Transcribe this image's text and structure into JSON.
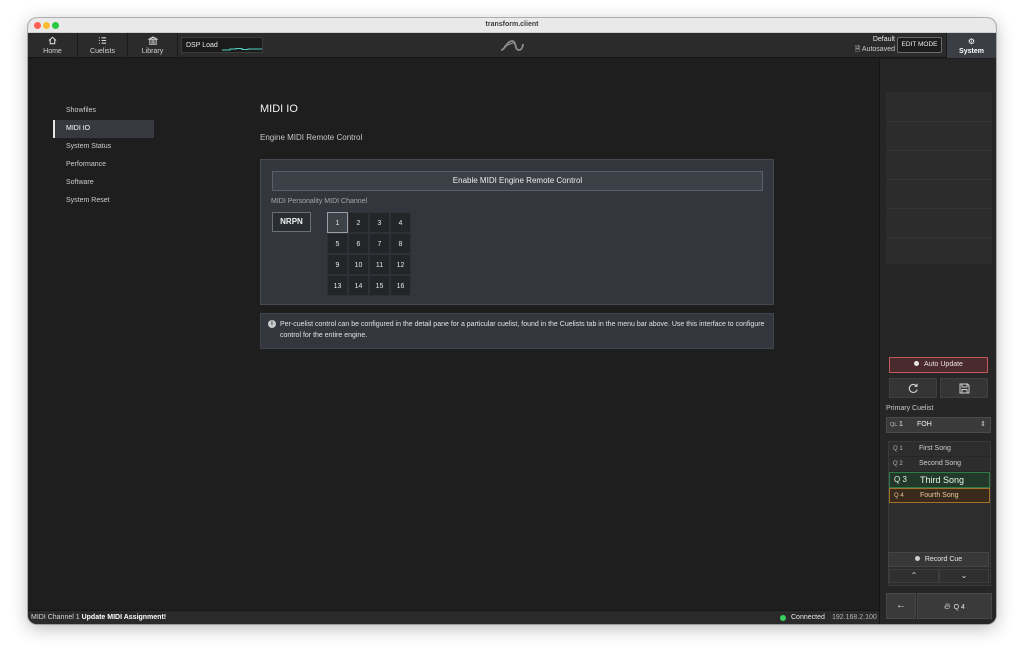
{
  "window": {
    "title": "transform.client"
  },
  "nav": {
    "home": {
      "label": "Home",
      "icon": "home-icon"
    },
    "cuelists": {
      "label": "Cuelists",
      "icon": "list-icon"
    },
    "library": {
      "label": "Library",
      "icon": "library-icon"
    },
    "dsp_label": "DSP Load",
    "preset": "Default",
    "autosaved": "Autosaved",
    "edit_mode": "EDIT MODE",
    "system": {
      "label": "System",
      "icon": "gear-icon"
    }
  },
  "sidebar": {
    "items": [
      {
        "label": "Showfiles",
        "active": false
      },
      {
        "label": "MIDI IO",
        "active": true
      },
      {
        "label": "System Status",
        "active": false
      },
      {
        "label": "Performance",
        "active": false
      },
      {
        "label": "Software",
        "active": false
      },
      {
        "label": "System Reset",
        "active": false
      }
    ]
  },
  "main": {
    "title": "MIDI IO",
    "section": "Engine MIDI Remote Control",
    "enable_button": "Enable MIDI Engine Remote Control",
    "channel_label": "MIDI Personality MIDI Channel",
    "nrpn_button": "NRPN",
    "channels": [
      "1",
      "2",
      "3",
      "4",
      "5",
      "6",
      "7",
      "8",
      "9",
      "10",
      "11",
      "12",
      "13",
      "14",
      "15",
      "16"
    ],
    "selected_channel": "1",
    "info_text": "Per-cuelist control can be configured in the detail pane for a particular cuelist, found in the Cuelists tab in the menu bar above. Use this interface to configure control for the entire engine."
  },
  "status": {
    "channel": "MIDI Channel 1",
    "message": "Update MIDI Assignment!",
    "connection": "Connected",
    "ip": "192.168.2.100"
  },
  "right_panel": {
    "auto_update": "Auto Update",
    "primary_label": "Primary Cuelist",
    "cuelist": {
      "ql": "QL",
      "number": "1",
      "name": "FOH"
    },
    "cues": [
      {
        "q": "Q 1",
        "name": "First Song",
        "state": "done"
      },
      {
        "q": "Q 2",
        "name": "Second Song",
        "state": "done"
      },
      {
        "q": "Q 3",
        "name": "Third Song",
        "state": "current"
      },
      {
        "q": "Q 4",
        "name": "Fourth Song",
        "state": "next"
      }
    ],
    "record_cue": "Record Cue",
    "go_cue": "Q 4"
  },
  "colors": {
    "accent_green": "#38d15c",
    "auto_update_red": "#c0585c",
    "current_cue_green": "#2f7a46",
    "next_cue_orange": "#a4702c"
  }
}
